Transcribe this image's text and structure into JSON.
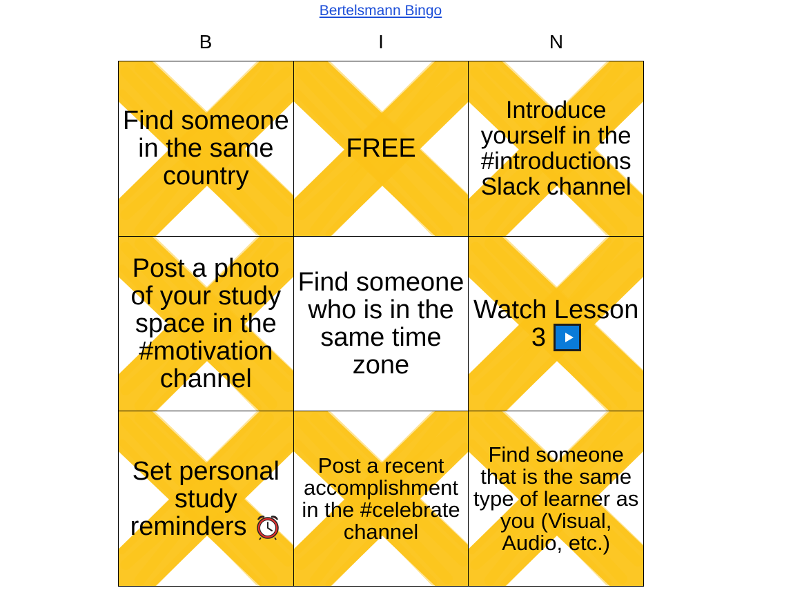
{
  "title": "Bertelsmann Bingo",
  "columns": [
    "B",
    "I",
    "N"
  ],
  "mark_color": "#fcc419",
  "cells": [
    {
      "text": "Find someone in the same country",
      "marked": true,
      "size": "l"
    },
    {
      "text": "FREE",
      "marked": true,
      "size": "l"
    },
    {
      "text": "Introduce yourself in the #introductions Slack channel",
      "marked": true,
      "size": "m"
    },
    {
      "text": "Post a photo of your study space in the #motivation channel",
      "marked": true,
      "size": "l"
    },
    {
      "text": "Find someone who is in the same time zone",
      "marked": false,
      "size": "l"
    },
    {
      "text": "Watch Lesson 3",
      "marked": true,
      "size": "l",
      "icon": "play-button-icon"
    },
    {
      "text": "Set personal study reminders",
      "marked": true,
      "size": "l",
      "icon": "alarm-clock-icon"
    },
    {
      "text": "Post a recent accomplishment in the #celebrate channel",
      "marked": true,
      "size": "s"
    },
    {
      "text": "Find someone that is the same type of learner as you (Visual, Audio, etc.)",
      "marked": true,
      "size": "s"
    }
  ]
}
